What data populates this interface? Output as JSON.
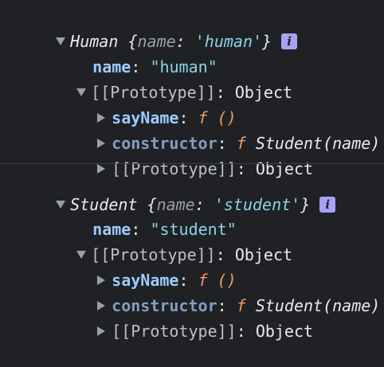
{
  "objects": [
    {
      "class_name": "Human",
      "preview_open": "{",
      "preview_key": "name",
      "preview_colon": ": ",
      "preview_value": "'human'",
      "preview_close": "}",
      "info_icon": "i",
      "prop_key": "name",
      "prop_value": "\"human\"",
      "proto_label": "[[Prototype]]",
      "proto_value": "Object",
      "say_key": "sayName",
      "say_value": "f ()",
      "ctor_key": "constructor",
      "ctor_f": "f",
      "ctor_value": "Student(name)",
      "inner_proto_label": "[[Prototype]]",
      "inner_proto_value": "Object"
    },
    {
      "class_name": "Student",
      "preview_open": "{",
      "preview_key": "name",
      "preview_colon": ": ",
      "preview_value": "'student'",
      "preview_close": "}",
      "info_icon": "i",
      "prop_key": "name",
      "prop_value": "\"student\"",
      "proto_label": "[[Prototype]]",
      "proto_value": "Object",
      "say_key": "sayName",
      "say_value": "f ()",
      "ctor_key": "constructor",
      "ctor_f": "f",
      "ctor_value": "Student(name)",
      "inner_proto_label": "[[Prototype]]",
      "inner_proto_value": "Object"
    }
  ],
  "colon": ": ",
  "icons": {
    "expand": "chevron-down-icon",
    "collapse": "chevron-right-icon",
    "info": "info-icon"
  }
}
